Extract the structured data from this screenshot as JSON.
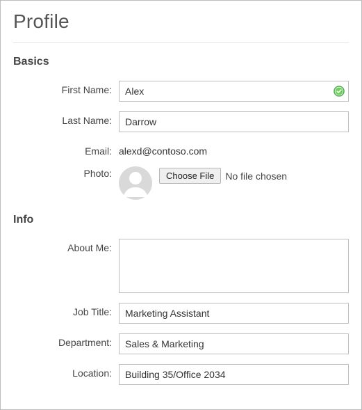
{
  "page": {
    "title": "Profile"
  },
  "sections": {
    "basics": {
      "heading": "Basics",
      "first_name": {
        "label": "First Name:",
        "value": "Alex",
        "valid": true
      },
      "last_name": {
        "label": "Last Name:",
        "value": "Darrow"
      },
      "email": {
        "label": "Email:",
        "value": "alexd@contoso.com"
      },
      "photo": {
        "label": "Photo:",
        "button": "Choose File",
        "status": "No file chosen"
      }
    },
    "info": {
      "heading": "Info",
      "about_me": {
        "label": "About Me:",
        "value": ""
      },
      "job_title": {
        "label": "Job Title:",
        "value": "Marketing Assistant"
      },
      "department": {
        "label": "Department:",
        "value": "Sales & Marketing"
      },
      "location": {
        "label": "Location:",
        "value": "Building 35/Office 2034"
      }
    }
  }
}
